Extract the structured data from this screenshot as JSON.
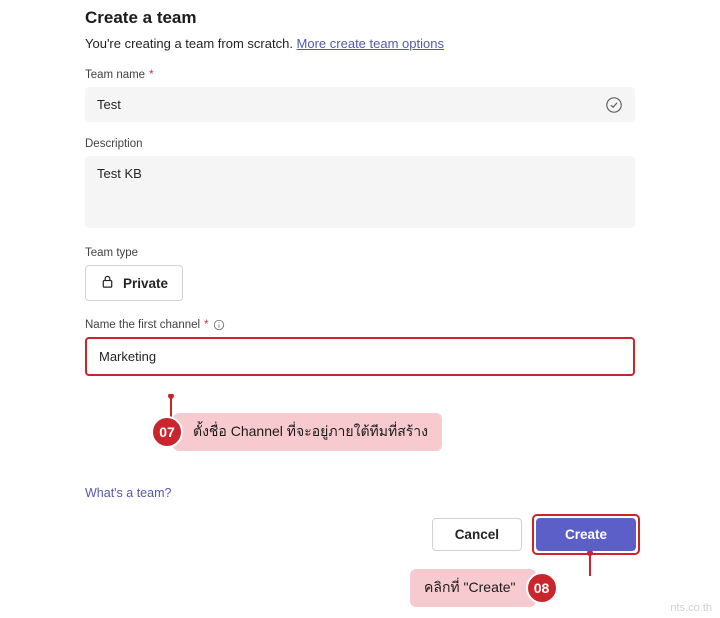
{
  "header": {
    "title": "Create a team",
    "subtitle": "You're creating a team from scratch. ",
    "link": "More create team options"
  },
  "teamName": {
    "label": "Team name",
    "value": "Test"
  },
  "description": {
    "label": "Description",
    "value": "Test KB"
  },
  "teamType": {
    "label": "Team type",
    "value": "Private"
  },
  "channel": {
    "label": "Name the first channel",
    "value": "Marketing"
  },
  "help": {
    "link": "What's a team?"
  },
  "buttons": {
    "cancel": "Cancel",
    "create": "Create"
  },
  "annotations": {
    "step07": {
      "num": "07",
      "text": "ตั้งชื่อ Channel ที่จะอยู่ภายใต้ทีมที่สร้าง"
    },
    "step08": {
      "num": "08",
      "text": "คลิกที่ \"Create\""
    }
  },
  "watermark": "nts.co.th"
}
